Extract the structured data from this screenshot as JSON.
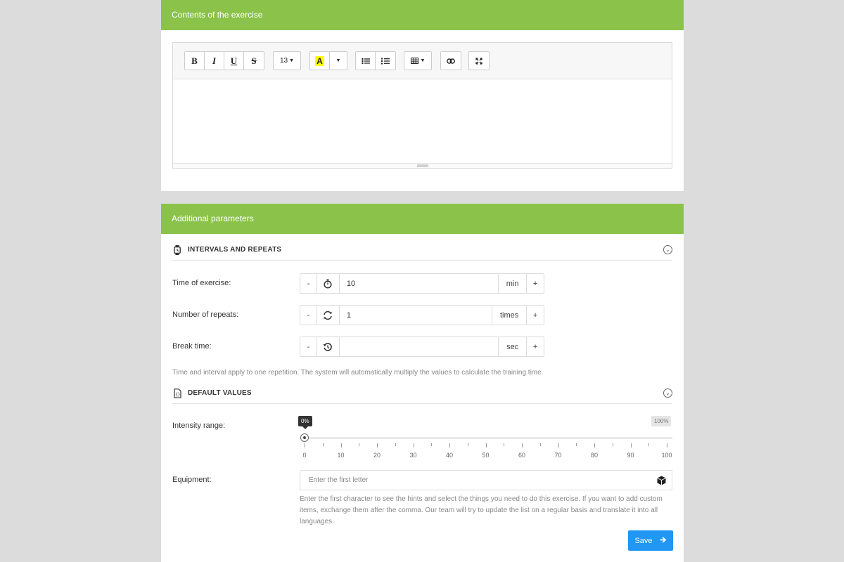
{
  "content_panel": {
    "title": "Contents of the exercise",
    "toolbar": {
      "bold": "B",
      "italic": "I",
      "underline": "U",
      "strike": "S",
      "font_size": "13",
      "color_letter": "A",
      "highlight_color": "#ffff00"
    }
  },
  "params_panel": {
    "title": "Additional parameters",
    "intervals": {
      "heading": "INTERVALS AND REPEATS",
      "rows": [
        {
          "label": "Time of exercise:",
          "minus": "-",
          "value": "10",
          "unit": "min",
          "plus": "+"
        },
        {
          "label": "Number of repeats:",
          "minus": "-",
          "value": "1",
          "unit": "times",
          "plus": "+"
        },
        {
          "label": "Break time:",
          "minus": "-",
          "value": "",
          "unit": "sec",
          "plus": "+"
        }
      ],
      "help": "Time and interval apply to one repetition. The system will automatically multiply the values to calculate the training time."
    },
    "defaults": {
      "heading": "DEFAULT VALUES",
      "intensity": {
        "label": "Intensity range:",
        "current": "0%",
        "max": "100%",
        "value": 0,
        "ticks": [
          "0",
          "10",
          "20",
          "30",
          "40",
          "50",
          "60",
          "70",
          "80",
          "90",
          "100"
        ]
      },
      "equipment": {
        "label": "Equipment:",
        "placeholder": "Enter the first letter",
        "value": "",
        "help": "Enter the first character to see the hints and select the things you need to do this exercise. If you want to add custom items, exchange them after the comma. Our team will try to update the list on a regular basis and translate it into all languages."
      }
    },
    "save_label": "Save"
  },
  "colors": {
    "header_green": "#8bc34a",
    "save_blue": "#2196f3"
  }
}
